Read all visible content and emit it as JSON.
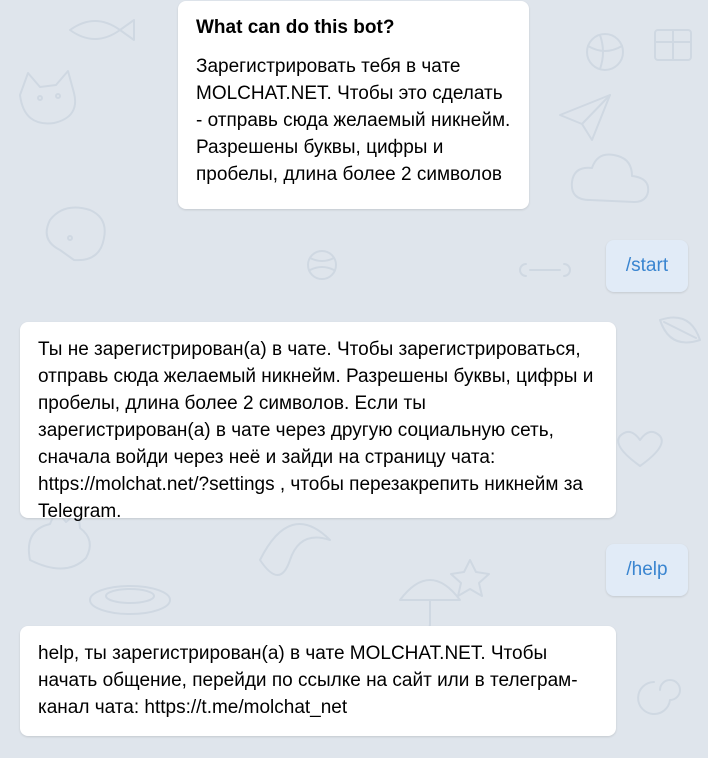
{
  "chat": {
    "intro": {
      "title": "What can do this bot?",
      "body": "Зарегистрировать тебя в чате MOLCHAT.NET. Чтобы это сделать - отправь сюда желаемый никнейм. Разрешены буквы, цифры и пробелы, длина более 2 символов"
    },
    "messages": [
      {
        "from": "user",
        "text": "/start"
      },
      {
        "from": "bot",
        "text": "Ты не зарегистрирован(а) в чате. Чтобы зарегистрироваться, отправь сюда желаемый никнейм. Разрешены буквы, цифры и пробелы, длина более 2 символов. Если ты зарегистрирован(а) в чате через другую социальную сеть, сначала войди через неё и зайди на страницу чата: https://molchat.net/?settings , чтобы перезакрепить никнейм за Telegram."
      },
      {
        "from": "user",
        "text": "/help"
      },
      {
        "from": "bot",
        "text": "help, ты зарегистрирован(а) в чате MOLCHAT.NET. Чтобы начать общение, перейди по ссылке на сайт или в телеграм-канал чата: https://t.me/molchat_net"
      }
    ]
  },
  "colors": {
    "background": "#dfe5ec",
    "bubble": "#ffffff",
    "command_bubble": "#e1ebf7",
    "command_text": "#3a85d0",
    "doodle_stroke": "#c9d3de"
  }
}
